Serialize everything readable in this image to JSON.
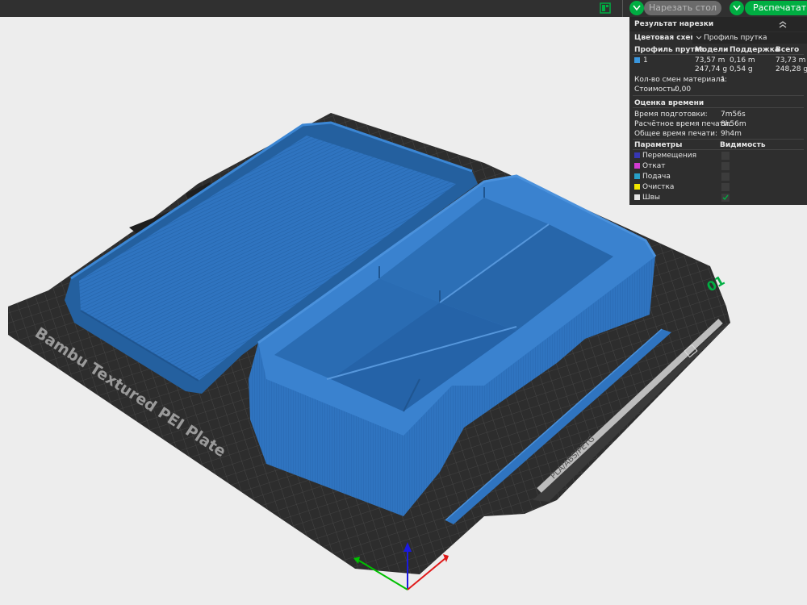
{
  "toolbar": {
    "slice_plate": "Нарезать стол",
    "print_plate": "Распечатать с",
    "icons": [
      "plate-layout-icon",
      "chevron-down-icon"
    ],
    "accent": "#00ae42"
  },
  "bed": {
    "label": "Bambu Textured PEI Plate",
    "plate_number": "01",
    "plate_number_color": "#00ae42",
    "material_label": "PLA/ABS/PETG"
  },
  "model": {
    "color": "#2f74c0"
  },
  "slice_result": {
    "title": "Результат нарезки",
    "color_scheme_label": "Цветовая схема",
    "color_scheme_value": "Профиль прутка",
    "columns": [
      "Профиль прутка",
      "Модели",
      "Поддержка",
      "Всего"
    ],
    "filament": {
      "id": "1",
      "color": "#3a96dd",
      "model_length": "73,57 m",
      "model_weight": "247,74 g",
      "support_length": "0,16 m",
      "support_weight": "0,54 g",
      "total_length": "73,73 m",
      "total_weight": "248,28 g"
    },
    "material_changes_label": "Кол-во смен материала:",
    "material_changes_value": "1",
    "cost_label": "Стоимость:",
    "cost_value": "0,00",
    "time_title": "Оценка времени",
    "prep_time_label": "Время подготовки:",
    "prep_time_value": "7m56s",
    "calc_time_label": "Расчётное время печати:",
    "calc_time_value": "8h56m",
    "total_time_label": "Общее время печати:",
    "total_time_value": "9h4m",
    "params_header": "Параметры",
    "visibility_header": "Видимость",
    "params": [
      {
        "label": "Перемещения",
        "color": "#3737b4",
        "visible": false
      },
      {
        "label": "Откат",
        "color": "#d23cd2",
        "visible": false
      },
      {
        "label": "Подача",
        "color": "#28a0c8",
        "visible": false
      },
      {
        "label": "Очистка",
        "color": "#f0e600",
        "visible": false
      },
      {
        "label": "Швы",
        "color": "#e6e6e6",
        "visible": true
      }
    ]
  }
}
